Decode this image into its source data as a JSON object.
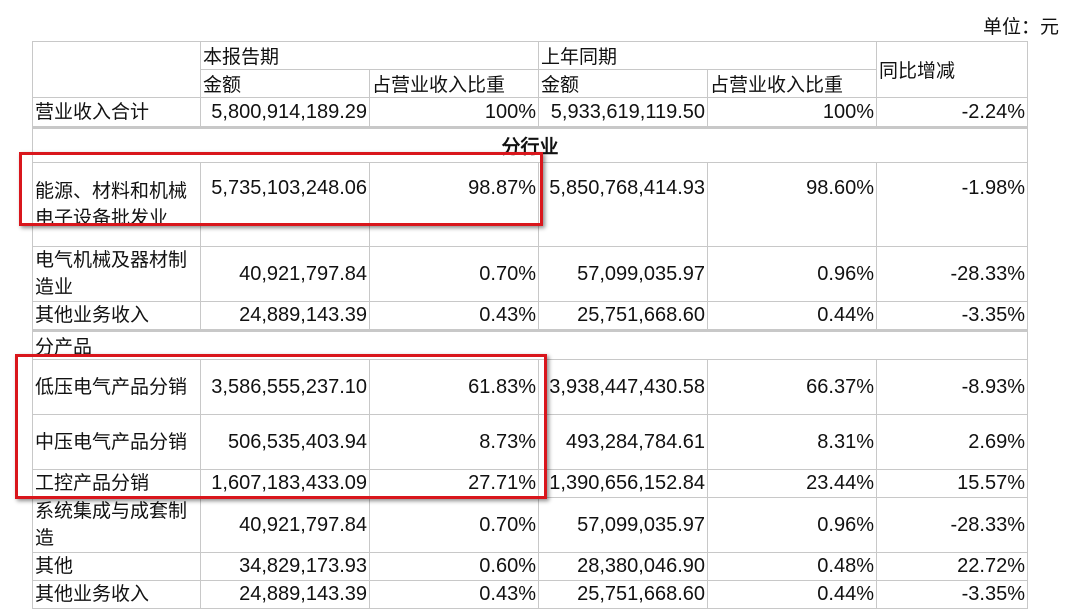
{
  "unit_label": "单位：元",
  "header": {
    "current_period": "本报告期",
    "prior_period": "上年同期",
    "amount": "金额",
    "ratio": "占营业收入比重",
    "yoy": "同比增减"
  },
  "total": {
    "label": "营业收入合计",
    "cur_amount": "5,800,914,189.29",
    "cur_ratio": "100%",
    "prev_amount": "5,933,619,119.50",
    "prev_ratio": "100%",
    "yoy": "-2.24%"
  },
  "by_industry": {
    "section_label": "分行业",
    "rows": [
      {
        "label": "能源、材料和机械电子设备批发业",
        "cur_amount": "5,735,103,248.06",
        "cur_ratio": "98.87%",
        "prev_amount": "5,850,768,414.93",
        "prev_ratio": "98.60%",
        "yoy": "-1.98%"
      },
      {
        "label": "电气机械及器材制造业",
        "cur_amount": "40,921,797.84",
        "cur_ratio": "0.70%",
        "prev_amount": "57,099,035.97",
        "prev_ratio": "0.96%",
        "yoy": "-28.33%"
      },
      {
        "label": "其他业务收入",
        "cur_amount": "24,889,143.39",
        "cur_ratio": "0.43%",
        "prev_amount": "25,751,668.60",
        "prev_ratio": "0.44%",
        "yoy": "-3.35%"
      }
    ]
  },
  "by_product": {
    "section_label": "分产品",
    "rows": [
      {
        "label": "低压电气产品分销",
        "cur_amount": "3,586,555,237.10",
        "cur_ratio": "61.83%",
        "prev_amount": "3,938,447,430.58",
        "prev_ratio": "66.37%",
        "yoy": "-8.93%"
      },
      {
        "label": "中压电气产品分销",
        "cur_amount": "506,535,403.94",
        "cur_ratio": "8.73%",
        "prev_amount": "493,284,784.61",
        "prev_ratio": "8.31%",
        "yoy": "2.69%"
      },
      {
        "label": "工控产品分销",
        "cur_amount": "1,607,183,433.09",
        "cur_ratio": "27.71%",
        "prev_amount": "1,390,656,152.84",
        "prev_ratio": "23.44%",
        "yoy": "15.57%"
      },
      {
        "label": "系统集成与成套制造",
        "cur_amount": "40,921,797.84",
        "cur_ratio": "0.70%",
        "prev_amount": "57,099,035.97",
        "prev_ratio": "0.96%",
        "yoy": "-28.33%"
      },
      {
        "label": "其他",
        "cur_amount": "34,829,173.93",
        "cur_ratio": "0.60%",
        "prev_amount": "28,380,046.90",
        "prev_ratio": "0.48%",
        "yoy": "22.72%"
      },
      {
        "label": "其他业务收入",
        "cur_amount": "24,889,143.39",
        "cur_ratio": "0.43%",
        "prev_amount": "25,751,668.60",
        "prev_ratio": "0.44%",
        "yoy": "-3.35%"
      }
    ]
  },
  "highlight_color": "#d9161c"
}
